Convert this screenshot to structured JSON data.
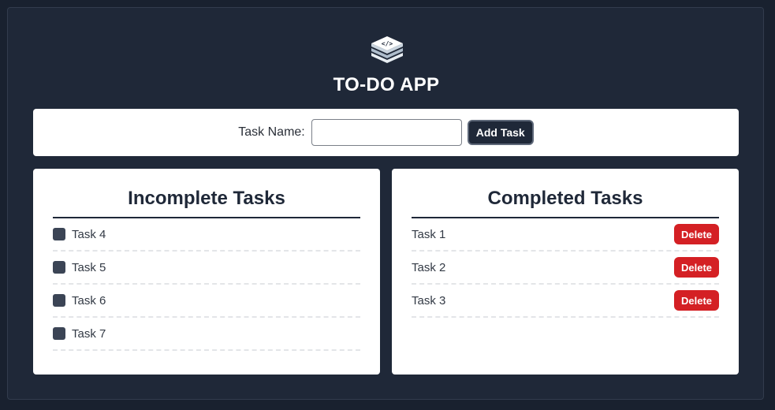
{
  "app": {
    "title": "TO-DO APP",
    "logo_icon": "layers-code-icon"
  },
  "form": {
    "label": "Task Name:",
    "input_value": "",
    "input_placeholder": "",
    "add_button_label": "Add Task"
  },
  "incomplete": {
    "heading": "Incomplete Tasks",
    "items": [
      {
        "label": "Task 4",
        "checked": false
      },
      {
        "label": "Task 5",
        "checked": false
      },
      {
        "label": "Task 6",
        "checked": false
      },
      {
        "label": "Task 7",
        "checked": false
      }
    ]
  },
  "completed": {
    "heading": "Completed Tasks",
    "delete_label": "Delete",
    "items": [
      {
        "label": "Task 1"
      },
      {
        "label": "Task 2"
      },
      {
        "label": "Task 3"
      }
    ]
  },
  "colors": {
    "background": "#19212f",
    "frame": "#1f2838",
    "delete": "#d42024",
    "checkbox": "#3b4455"
  }
}
